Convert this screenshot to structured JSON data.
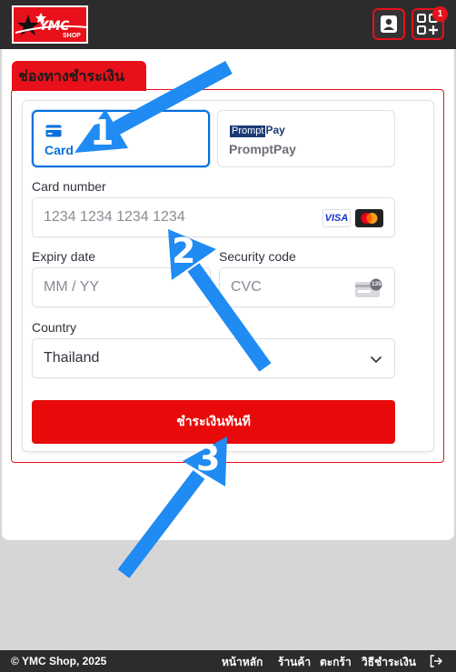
{
  "header": {
    "logo_text": "YMC",
    "logo_subtext": "SHOP",
    "cart_badge": "1",
    "user_icon": "user-icon",
    "qr_icon": "qr-add-icon"
  },
  "section": {
    "title": "ช่องทางชำระเงิน"
  },
  "payment_methods": [
    {
      "label": "Card",
      "icon": "credit-card-icon",
      "selected": true
    },
    {
      "label": "PromptPay",
      "logo_box": "Prompt",
      "logo_tail": "Pay",
      "selected": false
    }
  ],
  "form": {
    "card_number_label": "Card number",
    "card_number_placeholder": "1234 1234 1234 1234",
    "card_brands": [
      "VISA",
      "mastercard"
    ],
    "expiry_label": "Expiry date",
    "expiry_placeholder": "MM / YY",
    "security_label": "Security code",
    "security_placeholder": "CVC",
    "cvc_icon_text": "135",
    "country_label": "Country",
    "country_value": "Thailand"
  },
  "pay_button": "ชำระเงินทันที",
  "annotations": [
    "1",
    "2",
    "3"
  ],
  "footer": {
    "copyright": "© YMC Shop, 2025",
    "links": [
      "หน้าหลัก",
      "ร้านค้า",
      "ตะกร้า",
      "วิธีชำระเงิน"
    ],
    "logout_icon": "logout-icon"
  },
  "colors": {
    "brand_red": "#e8101a",
    "selected_blue": "#0570de",
    "arrow_blue": "#1f8bf3",
    "header_dark": "#2c2c2c"
  }
}
